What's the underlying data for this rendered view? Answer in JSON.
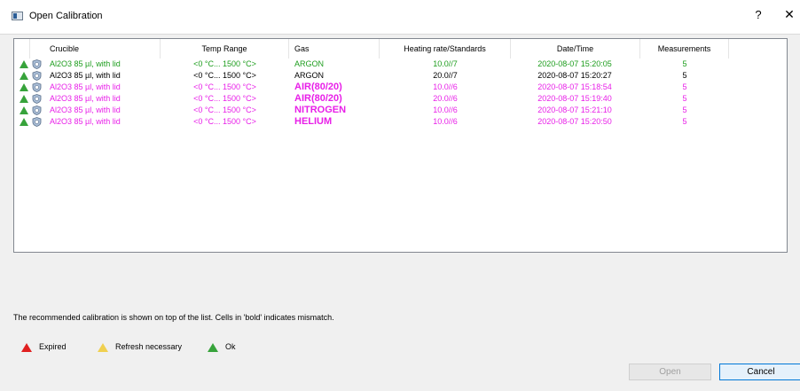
{
  "window": {
    "title": "Open Calibration",
    "help": "?",
    "close": "✕"
  },
  "table": {
    "headers": [
      "Crucible",
      "Temp Range",
      "Gas",
      "Heating rate/Standards",
      "Date/Time",
      "Measurements"
    ],
    "rows": [
      {
        "crucible": "Al2O3 85 µl, with lid",
        "temp": "<0 °C... 1500 °C>",
        "gas": "ARGON",
        "rate": "10.0//7",
        "date": "2020-08-07 15:20:05",
        "meas": "5",
        "color": "green",
        "gasBold": false
      },
      {
        "crucible": "Al2O3 85 µl, with lid",
        "temp": "<0 °C... 1500 °C>",
        "gas": "ARGON",
        "rate": "20.0//7",
        "date": "2020-08-07 15:20:27",
        "meas": "5",
        "color": "black",
        "gasBold": false
      },
      {
        "crucible": "Al2O3 85 µl, with lid",
        "temp": "<0 °C... 1500 °C>",
        "gas": "AIR(80/20)",
        "rate": "10.0//6",
        "date": "2020-08-07 15:18:54",
        "meas": "5",
        "color": "magenta",
        "gasBold": true
      },
      {
        "crucible": "Al2O3 85 µl, with lid",
        "temp": "<0 °C... 1500 °C>",
        "gas": "AIR(80/20)",
        "rate": "20.0//6",
        "date": "2020-08-07 15:19:40",
        "meas": "5",
        "color": "magenta",
        "gasBold": true
      },
      {
        "crucible": "Al2O3 85 µl, with lid",
        "temp": "<0 °C... 1500 °C>",
        "gas": "NITROGEN",
        "rate": "10.0//6",
        "date": "2020-08-07 15:21:10",
        "meas": "5",
        "color": "magenta",
        "gasBold": true
      },
      {
        "crucible": "Al2O3 85 µl, with lid",
        "temp": "<0 °C... 1500 °C>",
        "gas": "HELIUM",
        "rate": "10.0//6",
        "date": "2020-08-07 15:20:50",
        "meas": "5",
        "color": "magenta",
        "gasBold": true
      }
    ]
  },
  "info": "The recommended calibration is shown on top of the list. Cells in 'bold' indicates mismatch.",
  "legend": [
    {
      "label": "Expired",
      "color": "#e02020"
    },
    {
      "label": "Refresh necessary",
      "color": "#f0d050"
    },
    {
      "label": "Ok",
      "color": "#37a33b"
    }
  ],
  "buttons": {
    "open": "Open",
    "cancel": "Cancel"
  },
  "colors": {
    "green": "#1d9d1d",
    "black": "#000000",
    "magenta": "#e81fe8"
  },
  "icons": {
    "status": "status-triangle-icon",
    "crucible": "crucible-shield-icon"
  }
}
